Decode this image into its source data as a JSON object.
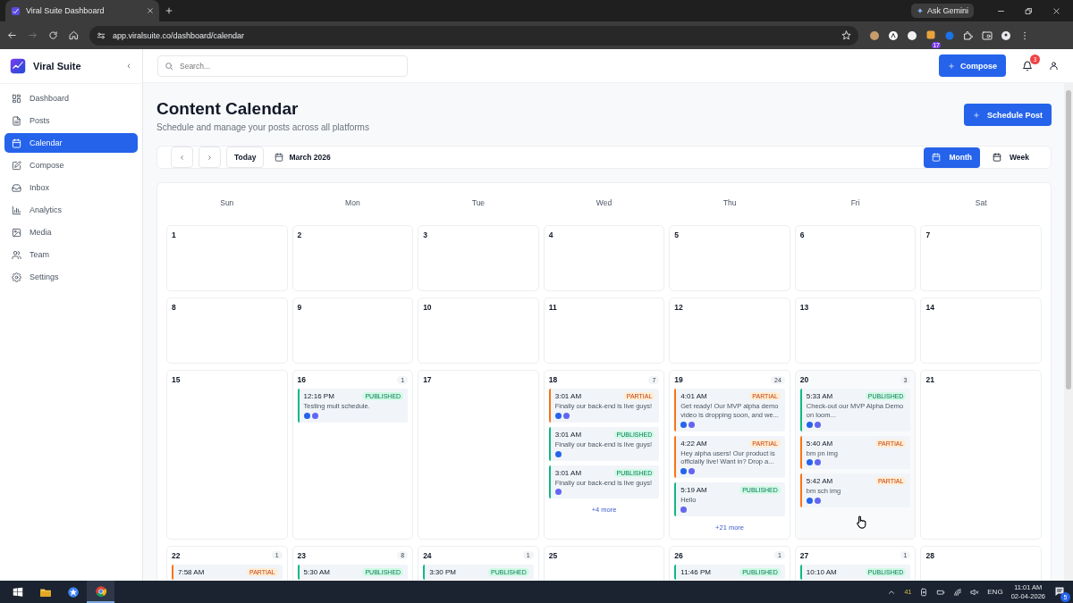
{
  "browser": {
    "tab_title": "Viral Suite Dashboard",
    "url": "app.viralsuite.co/dashboard/calendar",
    "ask_gemini": "Ask Gemini",
    "extension_badge": "17"
  },
  "sidebar": {
    "brand": "Viral Suite",
    "items": [
      {
        "label": "Dashboard",
        "selected": false
      },
      {
        "label": "Posts",
        "selected": false
      },
      {
        "label": "Calendar",
        "selected": true
      },
      {
        "label": "Compose",
        "selected": false
      },
      {
        "label": "Inbox",
        "selected": false
      },
      {
        "label": "Analytics",
        "selected": false
      },
      {
        "label": "Media",
        "selected": false
      },
      {
        "label": "Team",
        "selected": false
      },
      {
        "label": "Settings",
        "selected": false
      }
    ]
  },
  "header": {
    "search_placeholder": "Search...",
    "compose": "Compose",
    "notification_count": "3"
  },
  "page": {
    "title": "Content Calendar",
    "subtitle": "Schedule and manage your posts across all platforms",
    "schedule_button": "Schedule Post"
  },
  "toolbar": {
    "today": "Today",
    "month_label": "March 2026",
    "views": [
      {
        "label": "Month",
        "selected": true
      },
      {
        "label": "Week",
        "selected": false
      }
    ]
  },
  "calendar": {
    "weekdays": [
      "Sun",
      "Mon",
      "Tue",
      "Wed",
      "Thu",
      "Fri",
      "Sat"
    ],
    "weeks": [
      [
        {
          "day": "1"
        },
        {
          "day": "2"
        },
        {
          "day": "3"
        },
        {
          "day": "4"
        },
        {
          "day": "5"
        },
        {
          "day": "6"
        },
        {
          "day": "7"
        }
      ],
      [
        {
          "day": "8"
        },
        {
          "day": "9"
        },
        {
          "day": "10"
        },
        {
          "day": "11"
        },
        {
          "day": "12"
        },
        {
          "day": "13"
        },
        {
          "day": "14"
        }
      ],
      [
        {
          "day": "15"
        },
        {
          "day": "16",
          "count": "1",
          "posts": [
            {
              "time": "12:16 PM",
              "status": "PUBLISHED",
              "kind": "published",
              "text": "Testing mult schedule.",
              "platforms": [
                {
                  "color": "#2563eb"
                },
                {
                  "color": "#6366f1"
                }
              ]
            }
          ]
        },
        {
          "day": "17"
        },
        {
          "day": "18",
          "count": "7",
          "more": "+4 more",
          "posts": [
            {
              "time": "3:01 AM",
              "status": "PARTIAL",
              "kind": "partial",
              "text": "Finally our back-end is live guys!",
              "platforms": [
                {
                  "color": "#2563eb"
                },
                {
                  "color": "#6366f1"
                }
              ]
            },
            {
              "time": "3:01 AM",
              "status": "PUBLISHED",
              "kind": "published",
              "text": "Finally our back-end is live guys!",
              "platforms": [
                {
                  "color": "#2563eb"
                }
              ]
            },
            {
              "time": "3:01 AM",
              "status": "PUBLISHED",
              "kind": "published",
              "text": "Finally our back-end is live guys!",
              "platforms": [
                {
                  "color": "#6366f1"
                }
              ]
            }
          ]
        },
        {
          "day": "19",
          "count": "24",
          "more": "+21 more",
          "posts": [
            {
              "time": "4:01 AM",
              "status": "PARTIAL",
              "kind": "partial",
              "text": "Get ready! Our MVP alpha demo video is dropping soon, and we...",
              "platforms": [
                {
                  "color": "#2563eb"
                },
                {
                  "color": "#6366f1"
                }
              ]
            },
            {
              "time": "4:22 AM",
              "status": "PARTIAL",
              "kind": "partial",
              "text": "Hey alpha users! Our product is officially live! Want in? Drop a...",
              "platforms": [
                {
                  "color": "#2563eb"
                },
                {
                  "color": "#6366f1"
                }
              ]
            },
            {
              "time": "5:19 AM",
              "status": "PUBLISHED",
              "kind": "published",
              "text": "Hello",
              "platforms": [
                {
                  "color": "#6366f1"
                }
              ]
            }
          ]
        },
        {
          "day": "20",
          "count": "3",
          "hovered": true,
          "posts": [
            {
              "time": "5:33 AM",
              "status": "PUBLISHED",
              "kind": "published",
              "text": "Check-out our MVP Alpha Demo on loom...",
              "platforms": [
                {
                  "color": "#2563eb"
                },
                {
                  "color": "#6366f1"
                }
              ]
            },
            {
              "time": "5:40 AM",
              "status": "PARTIAL",
              "kind": "partial",
              "text": "bm pn img",
              "platforms": [
                {
                  "color": "#2563eb"
                },
                {
                  "color": "#6366f1"
                }
              ]
            },
            {
              "time": "5:42 AM",
              "status": "PARTIAL",
              "kind": "partial",
              "text": "bm sch img",
              "platforms": [
                {
                  "color": "#2563eb"
                },
                {
                  "color": "#6366f1"
                }
              ]
            }
          ]
        },
        {
          "day": "21"
        }
      ],
      [
        {
          "day": "22",
          "count": "1",
          "posts": [
            {
              "time": "7:58 AM",
              "status": "PARTIAL",
              "kind": "partial"
            }
          ]
        },
        {
          "day": "23",
          "count": "8",
          "posts": [
            {
              "time": "5:30 AM",
              "status": "PUBLISHED",
              "kind": "published"
            }
          ]
        },
        {
          "day": "24",
          "count": "1",
          "posts": [
            {
              "time": "3:30 PM",
              "status": "PUBLISHED",
              "kind": "published"
            }
          ]
        },
        {
          "day": "25"
        },
        {
          "day": "26",
          "count": "1",
          "posts": [
            {
              "time": "11:46 PM",
              "status": "PUBLISHED",
              "kind": "published"
            }
          ]
        },
        {
          "day": "27",
          "count": "1",
          "posts": [
            {
              "time": "10:10 AM",
              "status": "PUBLISHED",
              "kind": "published"
            }
          ]
        },
        {
          "day": "28"
        }
      ]
    ]
  },
  "taskbar": {
    "weather": "41",
    "language": "ENG",
    "time": "11:01 AM",
    "date": "02-04-2026",
    "notification_count": "5"
  }
}
